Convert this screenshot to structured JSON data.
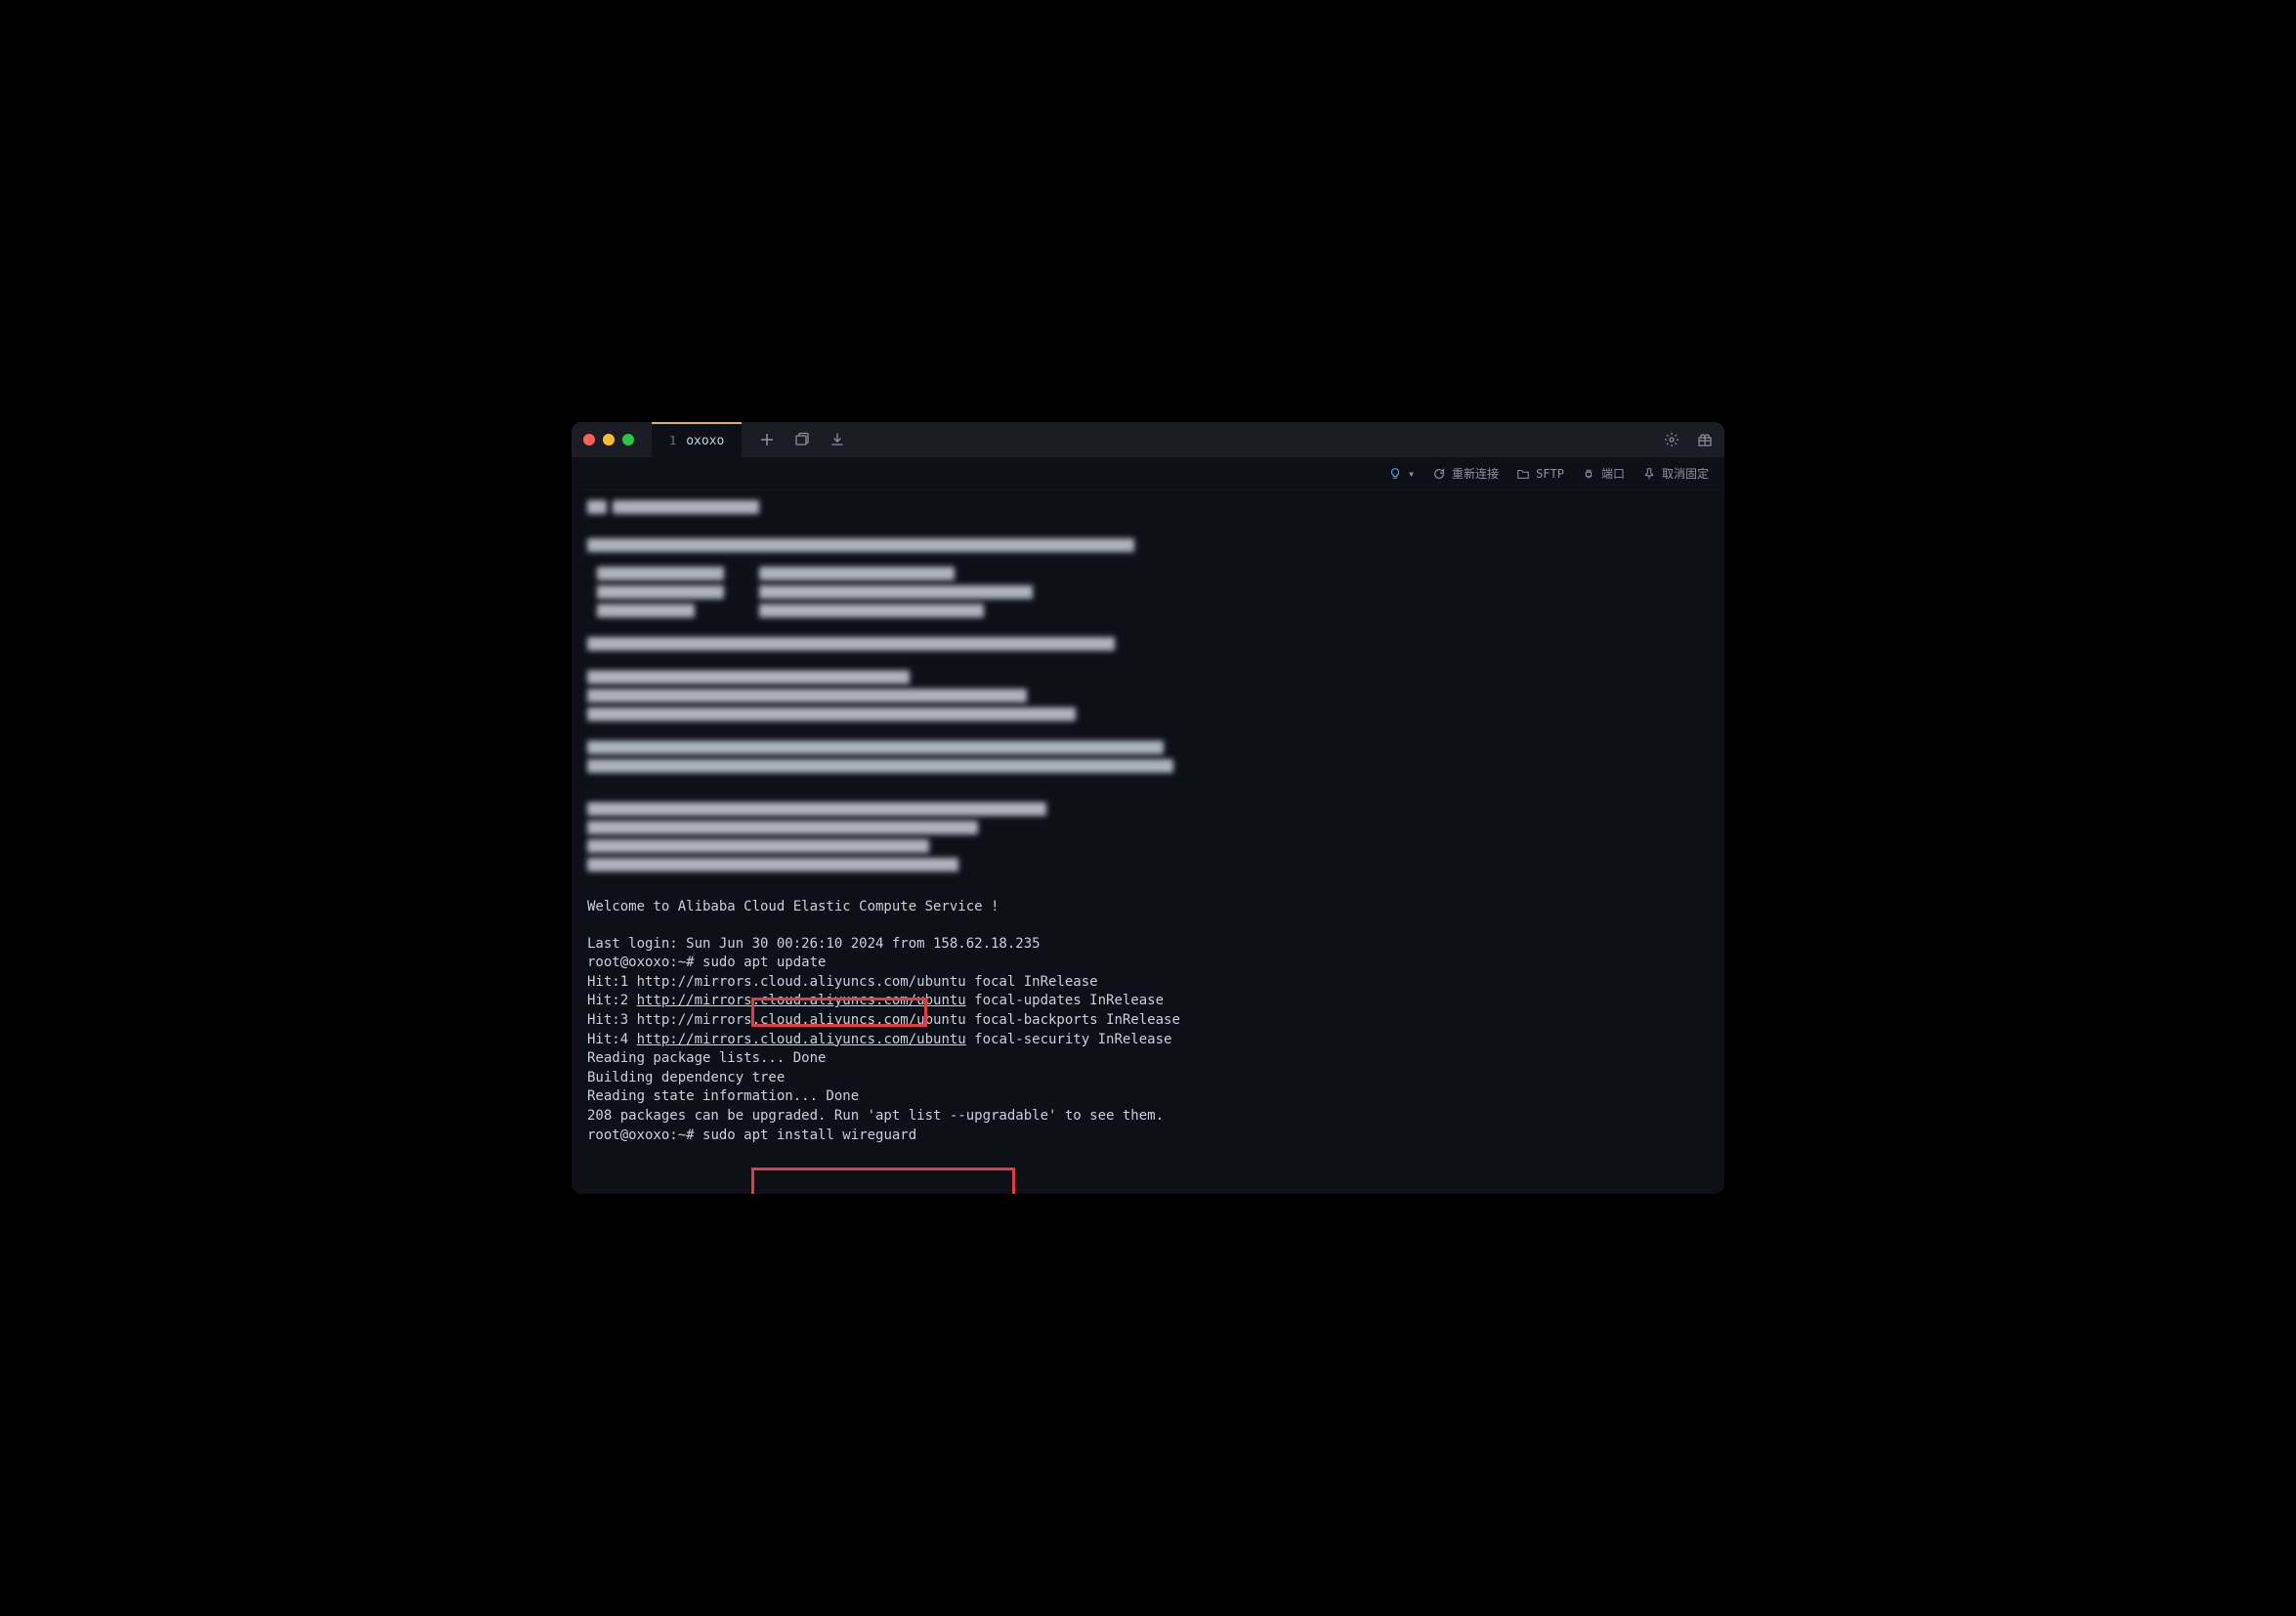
{
  "tab": {
    "index": "1",
    "title": "oxoxo"
  },
  "toolbar": {
    "reconnect": "重新连接",
    "sftp": "SFTP",
    "port": "端口",
    "unpin": "取消固定"
  },
  "terminal": {
    "welcome": "Welcome to Alibaba Cloud Elastic Compute Service !",
    "lastlogin": "Last login: Sun Jun 30 00:26:10 2024 from 158.62.18.235",
    "prompt1": "root@oxoxo:~# ",
    "cmd1": "sudo apt update",
    "hit1": "Hit:1 http://mirrors.cloud.aliyuncs.com/ubuntu focal InRelease",
    "hit2_a": "Hit:2 ",
    "hit2_link": "http://mirrors.cloud.aliyuncs.com/ubuntu",
    "hit2_b": " focal-updates InRelease",
    "hit3": "Hit:3 http://mirrors.cloud.aliyuncs.com/ubuntu focal-backports InRelease",
    "hit4_a": "Hit:4 ",
    "hit4_link": "http://mirrors.cloud.aliyuncs.com/ubuntu",
    "hit4_b": " focal-security InRelease",
    "reading1": "Reading package lists... Done",
    "building": "Building dependency tree",
    "reading2": "Reading state information... Done",
    "upgradable": "208 packages can be upgraded. Run 'apt list --upgradable' to see them.",
    "prompt2": "root@oxoxo:~# ",
    "cmd2": "sudo apt install wireguard"
  }
}
